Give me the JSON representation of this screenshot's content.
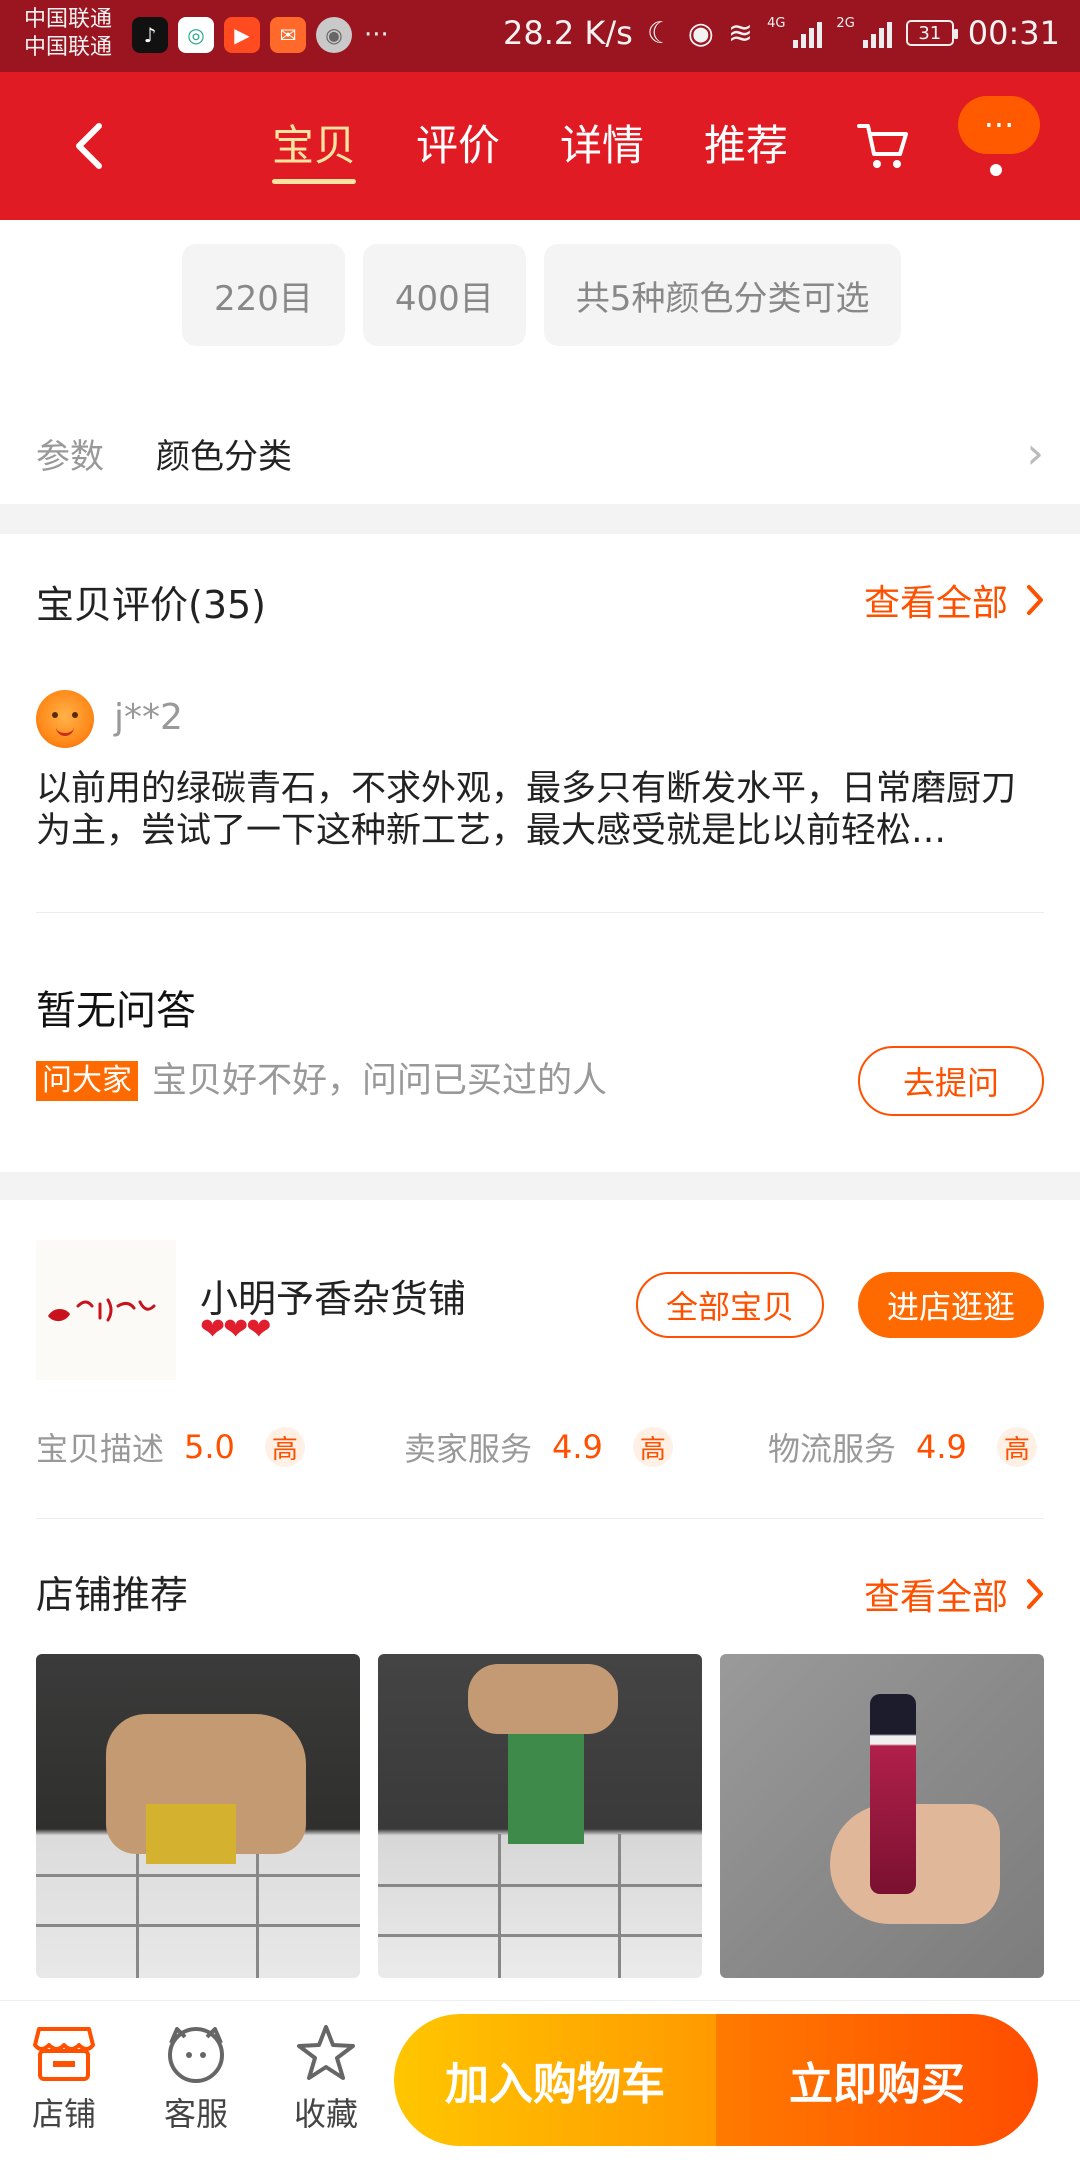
{
  "status_bar": {
    "carrier_1": "中国联通",
    "carrier_2": "中国联通",
    "more": "···",
    "speed": "28.2 K/s",
    "net_4g": "4G",
    "net_2g": "2G",
    "battery": "31",
    "time": "00:31"
  },
  "nav": {
    "tabs": [
      {
        "label": "宝贝"
      },
      {
        "label": "评价"
      },
      {
        "label": "详情"
      },
      {
        "label": "推荐"
      }
    ],
    "more_label": "···"
  },
  "sku": {
    "chips": [
      {
        "label": "220目"
      },
      {
        "label": "400目"
      },
      {
        "label": "共5种颜色分类可选"
      }
    ],
    "param_label": "参数",
    "param_value": "颜色分类"
  },
  "reviews": {
    "title": "宝贝评价(35)",
    "see_all": "查看全部",
    "user": "j**2",
    "text": "以前用的绿碳青石，不求外观，最多只有断发水平，日常磨厨刀为主，尝试了一下这种新工艺，最大感受就是比以前轻松…"
  },
  "qa": {
    "title": "暂无问答",
    "tag": "问大家",
    "hint": "宝贝好不好，问问已买过的人",
    "ask_button": "去提问"
  },
  "shop": {
    "name": "小明予香杂货铺",
    "hearts": "❤❤❤",
    "all_items": "全部宝贝",
    "enter": "进店逛逛",
    "ratings": [
      {
        "label": "宝贝描述",
        "value": "5.0",
        "level": "高"
      },
      {
        "label": "卖家服务",
        "value": "4.9",
        "level": "高"
      },
      {
        "label": "物流服务",
        "value": "4.9",
        "level": "高"
      }
    ]
  },
  "recommend": {
    "title": "店铺推荐",
    "see_all": "查看全部"
  },
  "bottom_bar": {
    "shop": "店铺",
    "service": "客服",
    "favorite": "收藏",
    "add_cart": "加入购物车",
    "buy_now": "立即购买"
  },
  "colors": {
    "accent": "#ff5000",
    "nav_red": "#e11b23",
    "cart_yellow": "#ffc600",
    "buy_orange": "#ff5a00"
  }
}
